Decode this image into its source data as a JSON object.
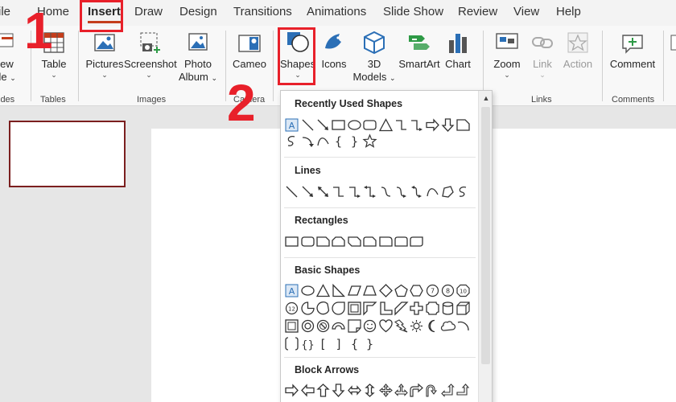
{
  "tabs": [
    "File",
    "Home",
    "Insert",
    "Draw",
    "Design",
    "Transitions",
    "Animations",
    "Slide Show",
    "Review",
    "View",
    "Help"
  ],
  "tabs_visible": [
    "ile",
    "Home",
    "Insert",
    "Draw",
    "Design",
    "Transitions",
    "Animations",
    "Slide Show",
    "Review",
    "View",
    "Help"
  ],
  "active_tab": "Insert",
  "ribbon": {
    "new_slide": {
      "line1": "lew",
      "line2": "de"
    },
    "table": "Table",
    "pictures": "Pictures",
    "screenshot": "Screenshot",
    "photo_album": {
      "line1": "Photo",
      "line2": "Album"
    },
    "cameo": "Cameo",
    "shapes": "Shapes",
    "icons": "Icons",
    "models_3d": {
      "line1": "3D",
      "line2": "Models"
    },
    "smartart": "SmartArt",
    "chart": "Chart",
    "zoom": "Zoom",
    "link": "Link",
    "action": "Action",
    "comment": "Comment",
    "groups": {
      "slides": "ides",
      "tables": "Tables",
      "images": "Images",
      "camera": "Camera",
      "links": "Links",
      "comments": "Comments"
    }
  },
  "dropdown": {
    "sections": [
      "Recently Used Shapes",
      "Lines",
      "Rectangles",
      "Basic Shapes",
      "Block Arrows"
    ],
    "brace_glyphs": [
      "{",
      "}",
      "{",
      "}",
      "[",
      "]",
      "{",
      "}"
    ]
  },
  "annotations": {
    "step1": "1",
    "step2": "2"
  },
  "colors": {
    "accent": "#c43e1c",
    "annotation": "#e8202a",
    "thumb_border": "#7b1f1f",
    "icon_blue": "#2b6fb6"
  }
}
